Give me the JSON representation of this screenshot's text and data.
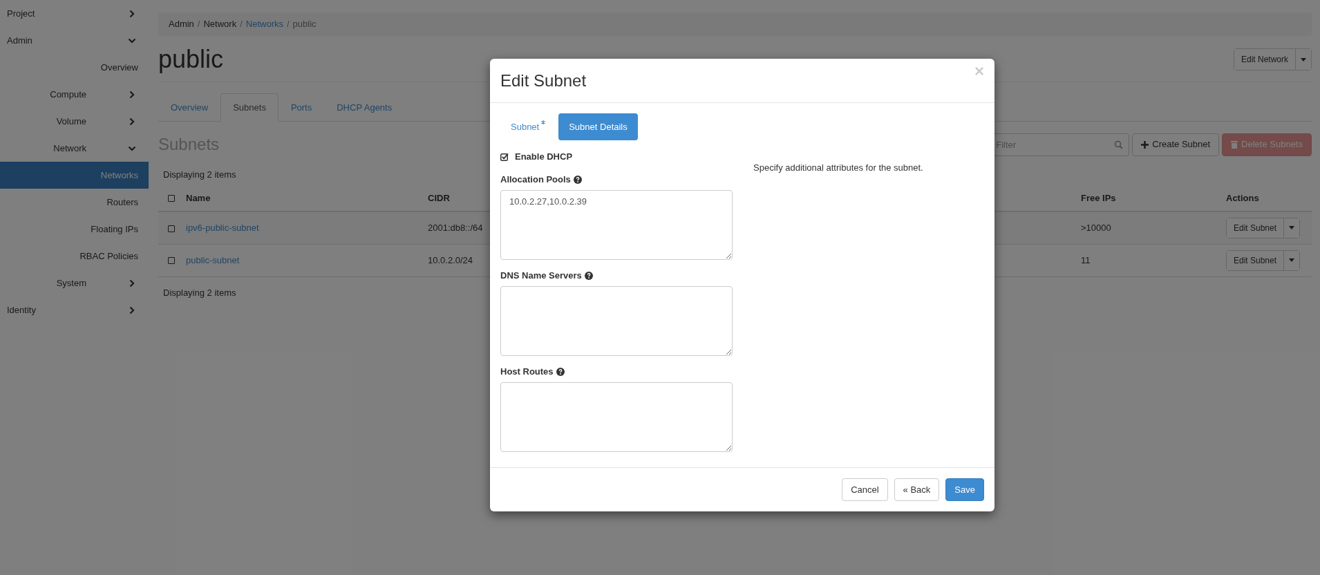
{
  "sidebar": {
    "items": [
      {
        "kind": "group",
        "label": "Project",
        "expanded": false
      },
      {
        "kind": "group",
        "label": "Admin",
        "expanded": true,
        "children": [
          {
            "kind": "link",
            "label": "Overview",
            "selected": false
          },
          {
            "kind": "group",
            "label": "Compute",
            "expanded": false
          },
          {
            "kind": "group",
            "label": "Volume",
            "expanded": false
          },
          {
            "kind": "group",
            "label": "Network",
            "expanded": true,
            "children": [
              {
                "kind": "link",
                "label": "Networks",
                "selected": true
              },
              {
                "kind": "link",
                "label": "Routers",
                "selected": false
              },
              {
                "kind": "link",
                "label": "Floating IPs",
                "selected": false
              },
              {
                "kind": "link",
                "label": "RBAC Policies",
                "selected": false
              }
            ]
          },
          {
            "kind": "group",
            "label": "System",
            "expanded": false
          }
        ]
      },
      {
        "kind": "group",
        "label": "Identity",
        "expanded": false
      }
    ]
  },
  "breadcrumb": [
    {
      "label": "Admin",
      "kind": "text"
    },
    {
      "separator": "/",
      "label": "Network",
      "kind": "text"
    },
    {
      "separator": "/",
      "label": "Networks",
      "kind": "link"
    },
    {
      "separator": "/",
      "label": "public",
      "kind": "current"
    }
  ],
  "page_title": "public",
  "header_button": "Edit Network",
  "tabs": [
    {
      "label": "Overview",
      "selected": false
    },
    {
      "label": "Subnets",
      "selected": true
    },
    {
      "label": "Ports",
      "selected": false
    },
    {
      "label": "DHCP Agents",
      "selected": false
    }
  ],
  "section_title": "Subnets",
  "filter": {
    "placeholder": "Filter"
  },
  "actions": [
    {
      "label": "Create Subnet",
      "kind": "create",
      "disabled": false
    },
    {
      "label": "Delete Subnets",
      "kind": "delete",
      "disabled": true
    }
  ],
  "table": {
    "count_top": "Displaying 2 items",
    "select_all": {
      "checked": false
    },
    "columns": [
      "Name",
      "CIDR",
      "Free IPs",
      "Actions"
    ],
    "rows": [
      {
        "checked": false,
        "name": "ipv6-public-subnet",
        "cidr": "2001:db8::/64",
        "free_ips": ">10000",
        "action": "Edit Subnet"
      },
      {
        "checked": false,
        "name": "public-subnet",
        "cidr": "10.0.2.0/24",
        "free_ips": "11",
        "action": "Edit Subnet"
      }
    ],
    "count_bottom": "Displaying 2 items"
  },
  "modal": {
    "title": "Edit Subnet",
    "close": "×",
    "steps": [
      {
        "label": "Subnet",
        "required": true,
        "selected": false
      },
      {
        "label": "Subnet Details",
        "required": false,
        "selected": true
      }
    ],
    "enable_dhcp": {
      "label": "Enable DHCP",
      "checked": true
    },
    "fields": [
      {
        "label": "Allocation Pools",
        "value": "10.0.2.27,10.0.2.39"
      },
      {
        "label": "DNS Name Servers"
      },
      {
        "label": "Host Routes"
      }
    ],
    "description": "Specify additional attributes for the subnet.",
    "buttons": [
      {
        "label": "Cancel",
        "kind": "default"
      },
      {
        "label": "« Back",
        "kind": "default"
      },
      {
        "label": "Save",
        "kind": "primary"
      }
    ]
  }
}
